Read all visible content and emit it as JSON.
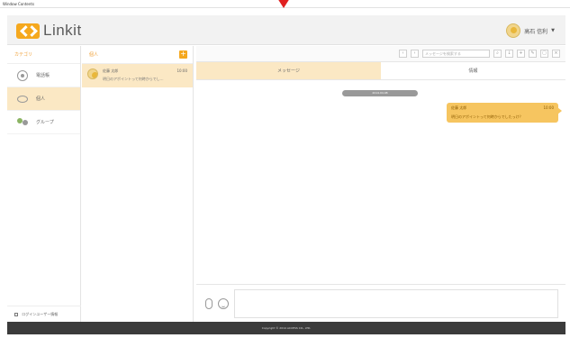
{
  "window": {
    "title": "Window Contents"
  },
  "header": {
    "app_name": "Linkit",
    "user_name": "高石 信利"
  },
  "sidebar": {
    "heading": "カテゴリ",
    "items": [
      {
        "label": "電話帳",
        "icon": "contacts-icon"
      },
      {
        "label": "個人",
        "icon": "chat-icon"
      },
      {
        "label": "グループ",
        "icon": "group-icon"
      }
    ],
    "footer": "ログインユーザー情報"
  },
  "thread_list": {
    "heading": "個人",
    "add_label": "+",
    "threads": [
      {
        "name": "佐藤 太郎",
        "time": "10:00",
        "preview": "明日のアポイントって何時からでし..."
      }
    ]
  },
  "toolbar": {
    "search_placeholder": "メッセージを検索する"
  },
  "tabs": [
    {
      "label": "メッセージ"
    },
    {
      "label": "情報"
    }
  ],
  "chat": {
    "date": "2014.04.08",
    "message": {
      "sender": "佐藤 太郎",
      "time": "10:00",
      "text": "明日のアポイントって何時からでしたっけ？"
    }
  },
  "composer": {
    "placeholder": ""
  },
  "footer": {
    "copyright": "Copyright © 2014 ACCESS CO., LTD."
  },
  "colors": {
    "accent": "#f5a81e",
    "accent_light": "#fbe8c4",
    "footer_bg": "#3b3b3b"
  }
}
